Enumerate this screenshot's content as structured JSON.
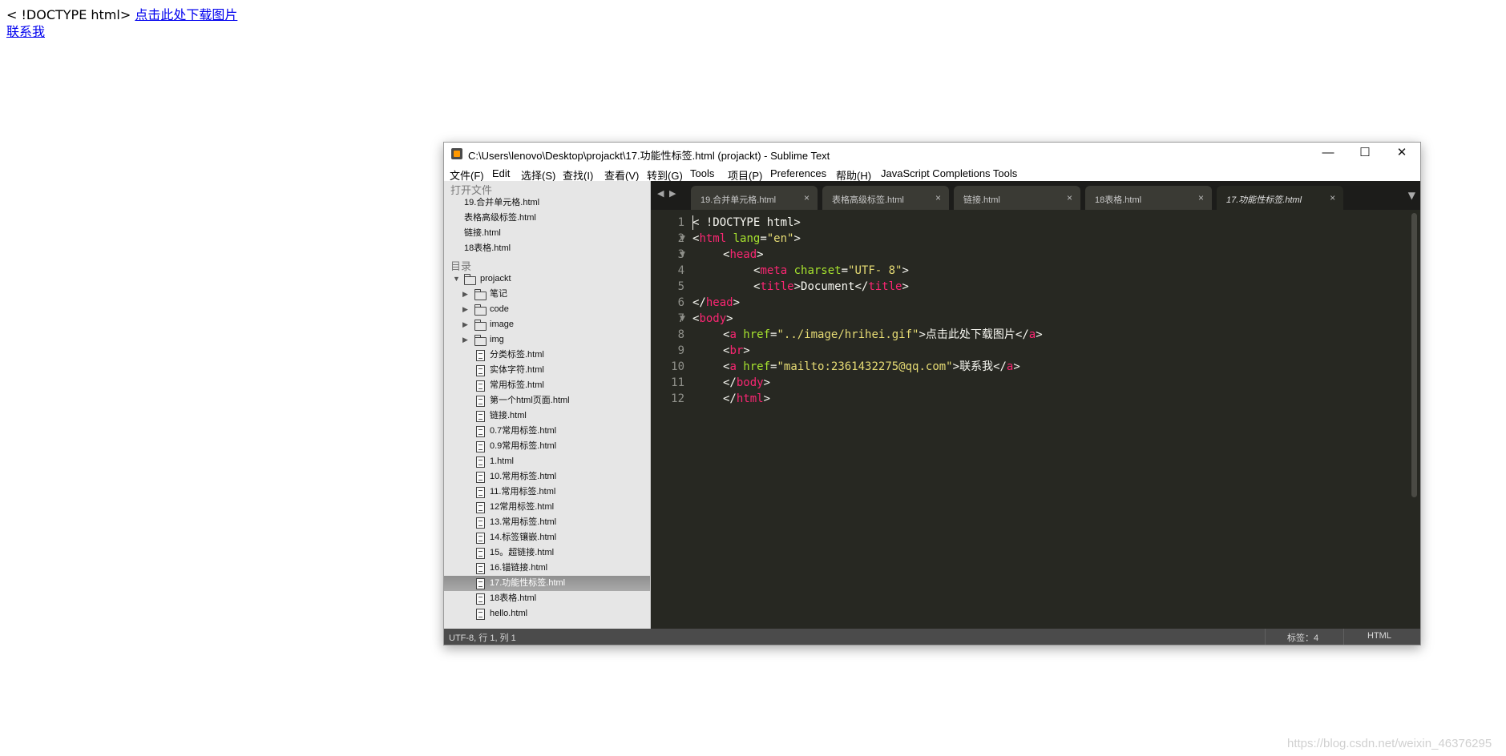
{
  "page": {
    "doctype_text": "< !DOCTYPE html>",
    "download_link": "点击此处下载图片",
    "contact_link": "联系我"
  },
  "window": {
    "title": "C:\\Users\\lenovo\\Desktop\\projackt\\17.功能性标签.html (projackt) - Sublime Text",
    "minimize": "—",
    "maximize": "☐",
    "close": "✕"
  },
  "menu": [
    "文件(F)",
    "Edit",
    "选择(S)",
    "查找(I)",
    "查看(V)",
    "转到(G)",
    "Tools",
    "项目(P)",
    "Preferences",
    "帮助(H)",
    "JavaScript Completions Tools"
  ],
  "sidebar": {
    "open_files_header": "打开文件",
    "open_files": [
      "19.合并单元格.html",
      "表格高级标签.html",
      "链接.html",
      "18表格.html"
    ],
    "folders_header": "目录",
    "project": "projackt",
    "folders": [
      "笔记",
      "code",
      "image",
      "img"
    ],
    "files": [
      "分类标签.html",
      "实体字符.html",
      "常用标签.html",
      "第一个html页面.html",
      "链接.html",
      "0.7常用标签.html",
      "0.9常用标签.html",
      "1.html",
      "10.常用标签.html",
      "11.常用标签.html",
      "12常用标签.html",
      "13.常用标签.html",
      "14.标签镶嵌.html",
      "15。超链接.html",
      "16.锚链接.html",
      "17.功能性标签.html",
      "18表格.html",
      "hello.html"
    ]
  },
  "tabs": [
    "19.合并单元格.html",
    "表格高级标签.html",
    "链接.html",
    "18表格.html",
    "17.功能性标签.html"
  ],
  "tab_close": "×",
  "tab_nav_prev": "◀",
  "tab_nav_next": "▶",
  "tab_menu": "▼",
  "editor": {
    "line_numbers": [
      "1",
      "2",
      "3",
      "4",
      "5",
      "6",
      "7",
      "8",
      "9",
      "10",
      "11",
      "12"
    ],
    "code": {
      "l1": "< !DOCTYPE html>",
      "l2_open": "<",
      "l2_tag": "html",
      "l2_attr": " lang",
      "l2_eq": "=",
      "l2_val": "\"en\"",
      "l2_close": ">",
      "l3_open": "<",
      "l3_tag": "head",
      "l3_close": ">",
      "l4_open": "<",
      "l4_tag": "meta",
      "l4_attr": " charset",
      "l4_eq": "=",
      "l4_val": "\"UTF- 8\"",
      "l4_close": ">",
      "l5_open": "<",
      "l5_tag": "title",
      "l5_mid1": ">",
      "l5_text": "Document",
      "l5_end_open": "</",
      "l5_end_tag": "title",
      "l5_close": ">",
      "l6_open": "</",
      "l6_tag": "head",
      "l6_close": ">",
      "l7_open": "<",
      "l7_tag": "body",
      "l7_close": ">",
      "l8_open": "<",
      "l8_tag": "a",
      "l8_attr": " href",
      "l8_eq": "=",
      "l8_val": "\"../image/hrihei.gif\"",
      "l8_mid": ">",
      "l8_text": "点击此处下载图片",
      "l8_end_open": "</",
      "l8_end_tag": "a",
      "l8_close": ">",
      "l9_open": "<",
      "l9_tag": "br",
      "l9_close": ">",
      "l10_open": "<",
      "l10_tag": "a",
      "l10_attr": " href",
      "l10_eq": "=",
      "l10_val": "\"mailto:2361432275@qq.com\"",
      "l10_mid": ">",
      "l10_text": "联系我",
      "l10_end_open": "</",
      "l10_end_tag": "a",
      "l10_close": ">",
      "l11_open": "</",
      "l11_tag": "body",
      "l11_close": ">",
      "l12_open": "</",
      "l12_tag": "html",
      "l12_close": ">"
    }
  },
  "status": {
    "left": "UTF-8, 行 1, 列 1",
    "tab_size": "标签：4",
    "syntax": "HTML"
  },
  "watermark": "https://blog.csdn.net/weixin_46376295"
}
